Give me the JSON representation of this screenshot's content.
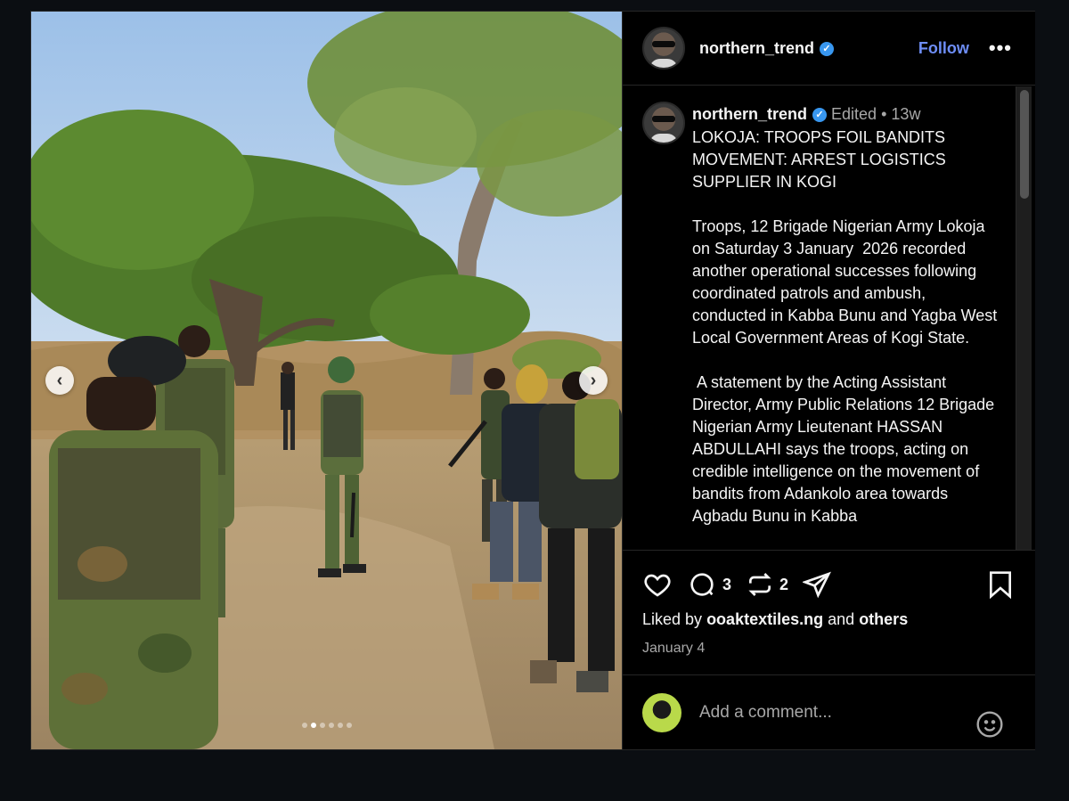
{
  "post": {
    "photo": {
      "carousel_total": 6,
      "carousel_active": 1
    },
    "header": {
      "username": "northern_trend",
      "verified": true,
      "follow_label": "Follow",
      "more_label": "•••"
    },
    "caption": {
      "username": "northern_trend",
      "edited_label": "Edited",
      "separator": "•",
      "time_ago": "13w",
      "text": "LOKOJA: TROOPS FOIL BANDITS MOVEMENT: ARREST LOGISTICS SUPPLIER IN KOGI\n\nTroops, 12 Brigade Nigerian Army Lokoja on Saturday 3 January  2026 recorded another operational successes following coordinated patrols and ambush, conducted in Kabba Bunu and Yagba West Local Government Areas of Kogi State.\n\n A statement by the Acting Assistant Director, Army Public Relations 12 Brigade Nigerian Army Lieutenant HASSAN ABDULLAHI says the troops, acting on credible intelligence on the movement of bandits from Adankolo area towards Agbadu Bunu in Kabba"
    },
    "actions": {
      "comment_count": "3",
      "repost_count": "2"
    },
    "likes": {
      "prefix": "Liked by",
      "user": "ooaktextiles.ng",
      "conjunction": "and",
      "others": "others"
    },
    "date": "January 4",
    "comment_box": {
      "placeholder": "Add a comment..."
    },
    "colors": {
      "background": "#0b0e12",
      "panel": "#000000",
      "accent_link": "#6e8ef7",
      "verified_badge": "#3897f0",
      "muted_text": "#a8a8a8"
    },
    "icons": [
      "heart-icon",
      "comment-icon",
      "repost-icon",
      "share-icon",
      "bookmark-icon",
      "emoji-icon",
      "chevron-left-icon",
      "chevron-right-icon",
      "verified-icon",
      "more-icon"
    ]
  }
}
